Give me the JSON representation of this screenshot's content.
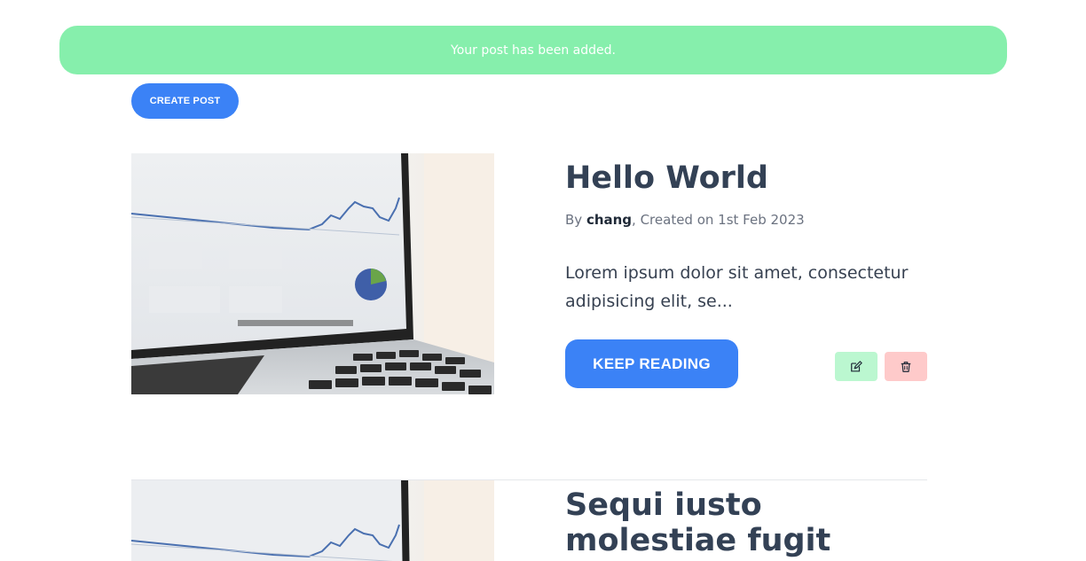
{
  "alert": {
    "message": "Your post has been added."
  },
  "toolbar": {
    "create_label": "CREATE POST"
  },
  "posts": [
    {
      "title": "Hello World",
      "meta_prefix": "By ",
      "author": "chang",
      "meta_suffix": ", Created on 1st Feb 2023",
      "excerpt": "Lorem ipsum dolor sit amet, consectetur adipisicing elit, se...",
      "keep_label": "KEEP READING",
      "edit_icon": "pencil-square-icon",
      "delete_icon": "trash-icon"
    },
    {
      "title": "Sequi iusto molestiae fugit"
    }
  ],
  "colors": {
    "alert_bg": "#86efac",
    "primary": "#3b82f6",
    "edit_bg": "#bbf7d0",
    "delete_bg": "#fecaca"
  }
}
